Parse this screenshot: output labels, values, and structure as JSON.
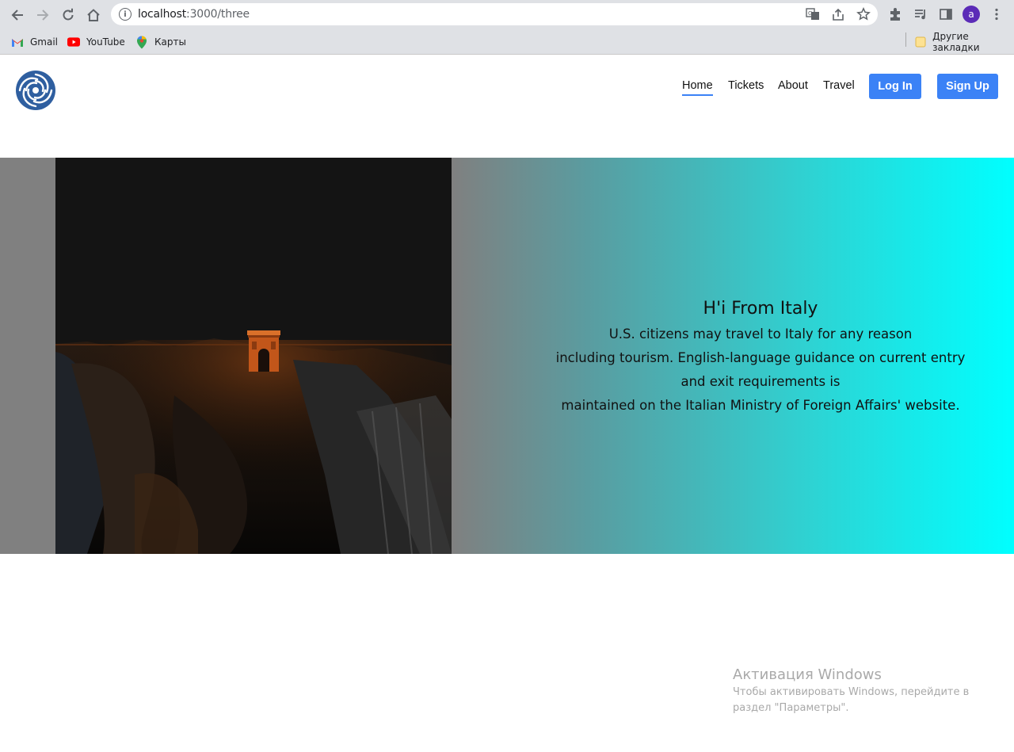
{
  "browser": {
    "url_host": "localhost",
    "url_path": ":3000/three",
    "bookmarks": [
      {
        "label": "Gmail",
        "icon": "gmail-icon"
      },
      {
        "label": "YouTube",
        "icon": "youtube-icon"
      },
      {
        "label": "Карты",
        "icon": "maps-icon"
      }
    ],
    "other_bookmarks": "Другие закладки",
    "profile_initial": "a"
  },
  "nav": {
    "links": [
      "Home",
      "Tickets",
      "About",
      "Travel"
    ],
    "active": "Home",
    "login_label": "Log In",
    "signup_label": "Sign Up",
    "accent_color": "#3b82f6"
  },
  "hero": {
    "title": "H'i From Italy",
    "lines": [
      "U.S. citizens may travel to Italy for any reason",
      "including tourism. English-language guidance on current entry",
      "and exit requirements is",
      "maintained on the Italian Ministry of Foreign Affairs' website."
    ],
    "gradient_colors": [
      "#808080",
      "#00ffff"
    ]
  },
  "windows_activation": {
    "title": "Активация Windows",
    "line1": "Чтобы активировать Windows, перейдите в",
    "line2": "раздел \"Параметры\"."
  }
}
